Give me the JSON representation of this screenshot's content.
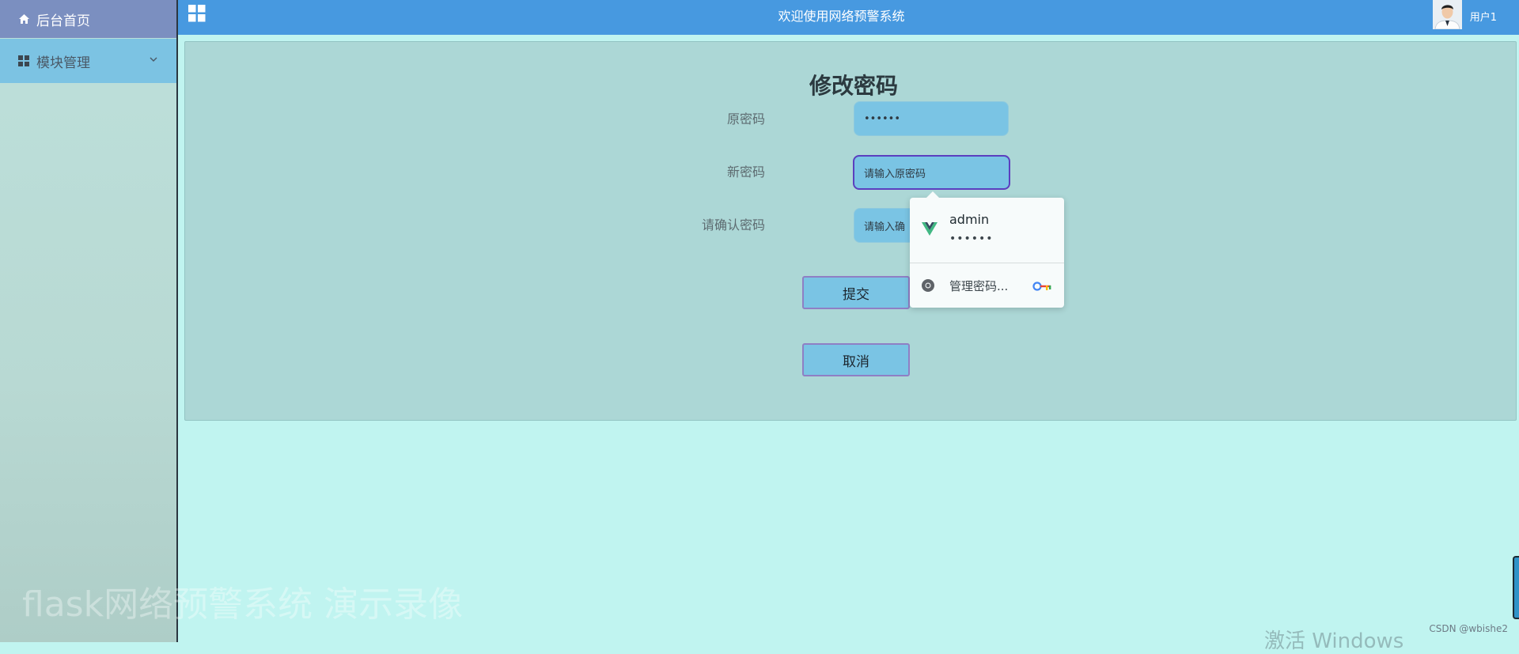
{
  "sidebar": {
    "home_label": "后台首页",
    "module_label": "模块管理",
    "watermark": "flask网络预警系统 演示录像"
  },
  "header": {
    "title": "欢迎使用网络预警系统",
    "username": "用户1"
  },
  "form": {
    "title": "修改密码",
    "old_password_label": "原密码",
    "old_password_value": "••••••",
    "new_password_label": "新密码",
    "new_password_value": "请输入原密码",
    "confirm_label": "请确认密码",
    "confirm_value": "请输入确",
    "submit_label": "提交",
    "cancel_label": "取消"
  },
  "autofill": {
    "username": "admin",
    "password_mask": "••••••",
    "manage_label": "管理密码..."
  },
  "overlay": {
    "activate_windows": "激活 Windows",
    "csdn_credit": "CSDN @wbishe2"
  },
  "colors": {
    "header_bg": "#4799e0",
    "sidebar_home_bg": "#7b8fc0",
    "sidebar_module_bg": "#7cc3e3",
    "card_bg": "#acd7d6",
    "input_bg": "#7ac4e4",
    "focus_border": "#5b3fbf",
    "page_bg": "#c0f4f0"
  },
  "icons": {
    "home": "home-icon",
    "module": "grid-icon",
    "chevron": "chevron-down-icon",
    "menu_toggle": "apps-grid-icon",
    "vue_logo": "vue-logo-icon",
    "chrome": "chrome-icon",
    "key": "key-icon"
  }
}
